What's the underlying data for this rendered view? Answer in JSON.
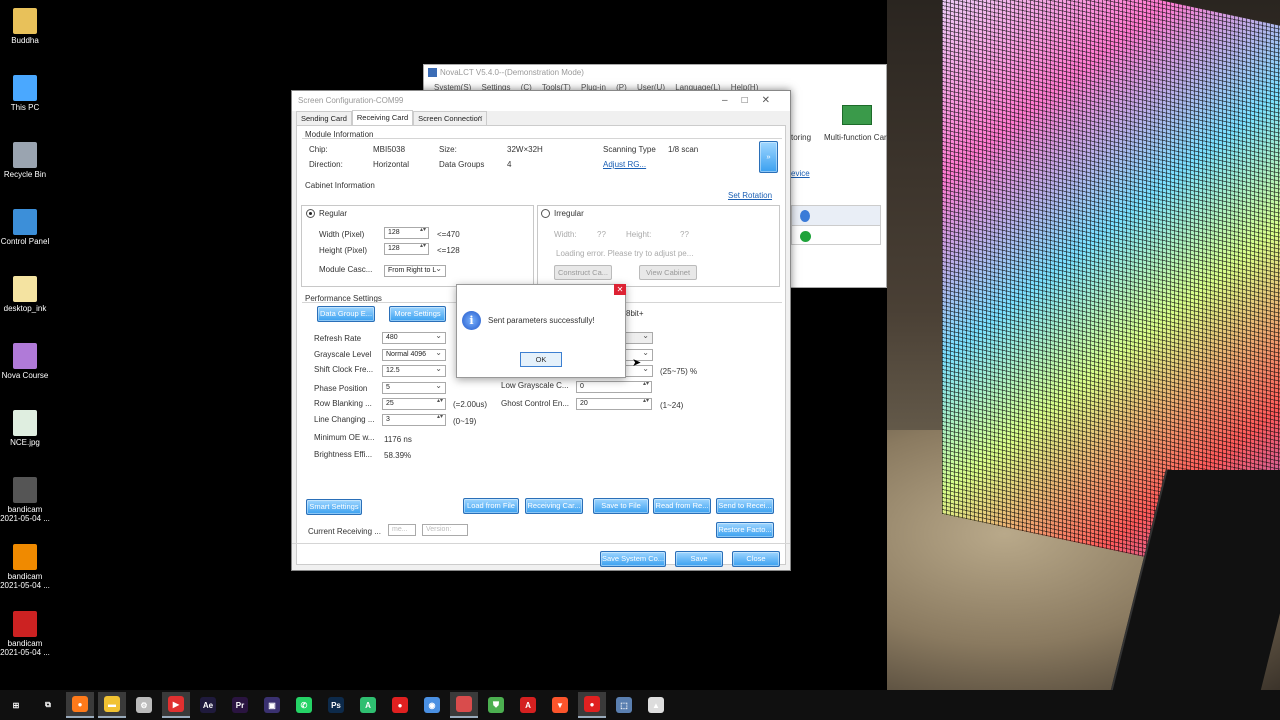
{
  "desktop_icons": [
    {
      "label": "Buddha",
      "icon": "folder-icon",
      "color": "#e8c15a"
    },
    {
      "label": "This PC",
      "icon": "monitor-icon",
      "color": "#4aa8ff"
    },
    {
      "label": "Recycle Bin",
      "icon": "recycle-bin-icon",
      "color": "#9aa4b0"
    },
    {
      "label": "Control Panel",
      "icon": "control-panel-icon",
      "color": "#3c8fd9"
    },
    {
      "label": "desktop_ink",
      "icon": "file-icon",
      "color": "#f4e3a1"
    },
    {
      "label": "Nova Course",
      "icon": "folder-icon",
      "color": "#b07ad8"
    },
    {
      "label": "NCE.jpg",
      "icon": "image-icon",
      "color": "#dfeee0"
    },
    {
      "label": "bandicam 2021-05-04 ...",
      "icon": "bandicam-file-icon",
      "color": "#555"
    },
    {
      "label": "bandicam 2021-05-04 ...",
      "icon": "vlc-icon",
      "color": "#f08a00"
    },
    {
      "label": "bandicam 2021-05-04 ...",
      "icon": "bandicam-icon",
      "color": "#cc2222"
    }
  ],
  "nova": {
    "title": "NovaLCT V5.4.0--(Demonstration Mode)",
    "menu": "System(S)  Settings (C)  Tools(T)  Plug-in (P)  User(U)  Language(L)  Help(H)",
    "monitoring": "toring",
    "multifunction": "Multi-function Car",
    "device": "evice"
  },
  "cfg": {
    "title": "Screen Configuration-COM99",
    "tabs": [
      "Sending Card",
      "Receiving Card",
      "Screen Connection"
    ],
    "module": {
      "heading": "Module Information",
      "chip_label": "Chip:",
      "chip": "MBI5038",
      "size_label": "Size:",
      "size": "32W×32H",
      "scan_label": "Scanning Type",
      "scan": "1/8 scan",
      "direction_label": "Direction:",
      "direction": "Horizontal",
      "groups_label": "Data Groups",
      "groups": "4",
      "adjust": "Adjust RG..."
    },
    "cabinet": {
      "heading": "Cabinet Information",
      "set_rotation": "Set Rotation",
      "regular": "Regular",
      "irregular": "Irregular",
      "width_label": "Width (Pixel)",
      "width": "128",
      "width_max": "<=470",
      "height_label": "Height (Pixel)",
      "height": "128",
      "height_max": "<=128",
      "cascade_label": "Module Casc...",
      "cascade": "From Right to L",
      "irr_width": "Width:",
      "irr_width_val": "??",
      "irr_height": "Height:",
      "irr_height_val": "??",
      "loading": "Loading error. Please try to adjust pe...",
      "construct": "Construct Ca...",
      "view": "View Cabinet"
    },
    "perf": {
      "heading": "Performance Settings",
      "data_group": "Data Group E...",
      "more": "More Settings",
      "bit": "8bit+",
      "refresh_label": "Refresh Rate",
      "refresh": "480",
      "gray_label": "Grayscale Level",
      "gray": "Normal 4096",
      "shift_label": "Shift Clock Fre...",
      "shift": "12.5",
      "phase_label": "Phase Position",
      "phase": "5",
      "row_label": "Row Blanking ...",
      "row": "25",
      "row_note": "(=2.00us)",
      "line_label": "Line Changing ...",
      "line": "3",
      "line_note": "(0~19)",
      "oe_label": "Minimum OE w...",
      "oe": "1176 ns",
      "eff_label": "Brightness Effi...",
      "eff": "58.39%",
      "duty_note": "(25~75) %",
      "low_gray_label": "Low Grayscale C...",
      "low_gray": "0",
      "ghost_label": "Ghost Control En...",
      "ghost": "20",
      "ghost_note": "(1~24)"
    },
    "buttons": {
      "smart": "Smart Settings",
      "load": "Load from File",
      "receiving": "Receiving Car...",
      "save_file": "Save to File",
      "read": "Read from Re...",
      "send": "Send to Recei...",
      "restore": "Restore Facto...",
      "current": "Current Receiving ...",
      "current_ph": "me...",
      "version_ph": "Version:",
      "save_system": "Save System Co...",
      "save": "Save",
      "close": "Close"
    }
  },
  "dialog": {
    "message": "Sent parameters successfully!",
    "ok": "OK"
  },
  "taskbar": [
    {
      "name": "start-icon",
      "text": "⊞",
      "color": "#fff"
    },
    {
      "name": "task-view-icon",
      "text": "⧉",
      "color": "#fff"
    },
    {
      "name": "firefox-icon",
      "text": "●",
      "color": "#ff7a1a"
    },
    {
      "name": "file-explorer-icon",
      "text": "▬",
      "color": "#f1c232"
    },
    {
      "name": "app-icon",
      "text": "⚙",
      "color": "#bbb"
    },
    {
      "name": "youtube-icon",
      "text": "▶",
      "color": "#e03030"
    },
    {
      "name": "after-effects-icon",
      "text": "Ae",
      "color": "#1f1a3c"
    },
    {
      "name": "premiere-icon",
      "text": "Pr",
      "color": "#2a1440"
    },
    {
      "name": "effects-icon",
      "text": "▣",
      "color": "#3a3170"
    },
    {
      "name": "whatsapp-icon",
      "text": "✆",
      "color": "#25d366"
    },
    {
      "name": "photoshop-icon",
      "text": "Ps",
      "color": "#0d2a4a"
    },
    {
      "name": "a-app-icon",
      "text": "A",
      "color": "#2fbf71"
    },
    {
      "name": "record-icon",
      "text": "●",
      "color": "#e02020"
    },
    {
      "name": "chrome-icon",
      "text": "◉",
      "color": "#4a90e2"
    },
    {
      "name": "red-app-icon",
      "text": "",
      "color": "#d94c4c"
    },
    {
      "name": "shield-icon",
      "text": "⛊",
      "color": "#4caf50"
    },
    {
      "name": "acrobat-icon",
      "text": "A",
      "color": "#d42020"
    },
    {
      "name": "brave-icon",
      "text": "▼",
      "color": "#fb542b"
    },
    {
      "name": "bandicam-icon",
      "text": "●",
      "color": "#e02020"
    },
    {
      "name": "novalct-icon",
      "text": "⬚",
      "color": "#5a7fb0"
    },
    {
      "name": "photos-icon",
      "text": "▲",
      "color": "#ddd"
    }
  ]
}
